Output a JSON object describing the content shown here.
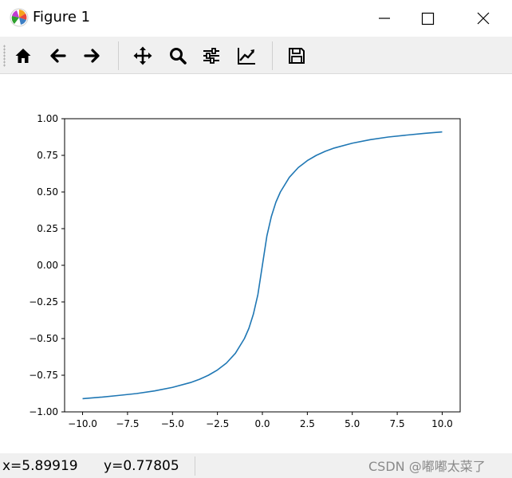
{
  "window": {
    "title": "Figure 1"
  },
  "toolbar": {
    "buttons": [
      {
        "name": "home",
        "icon": "home-icon"
      },
      {
        "name": "back",
        "icon": "arrow-left-icon"
      },
      {
        "name": "forward",
        "icon": "arrow-right-icon"
      },
      {
        "name": "pan",
        "icon": "move-icon"
      },
      {
        "name": "zoom",
        "icon": "magnifier-icon"
      },
      {
        "name": "configure-subplots",
        "icon": "sliders-icon"
      },
      {
        "name": "edit-axis",
        "icon": "line-chart-icon"
      },
      {
        "name": "save",
        "icon": "floppy-disk-icon"
      }
    ]
  },
  "status": {
    "x_readout": "x=5.89919",
    "y_readout": "y=0.77805",
    "watermark": "CSDN @嘟嘟太菜了"
  },
  "chart_data": {
    "type": "line",
    "title": "",
    "xlabel": "",
    "ylabel": "",
    "xlim": [
      -11.0,
      11.0
    ],
    "ylim": [
      -1.0,
      1.0
    ],
    "x_ticks": [
      -10.0,
      -7.5,
      -5.0,
      -2.5,
      0.0,
      2.5,
      5.0,
      7.5,
      10.0
    ],
    "x_tick_labels": [
      "−10.0",
      "−7.5",
      "−5.0",
      "−2.5",
      "0.0",
      "2.5",
      "5.0",
      "7.5",
      "10.0"
    ],
    "y_ticks": [
      -1.0,
      -0.75,
      -0.5,
      -0.25,
      0.0,
      0.25,
      0.5,
      0.75,
      1.0
    ],
    "y_tick_labels": [
      "−1.00",
      "−0.75",
      "−0.50",
      "−0.25",
      "0.00",
      "0.25",
      "0.50",
      "0.75",
      "1.00"
    ],
    "grid": false,
    "series": [
      {
        "color": "#1f77b4",
        "x": [
          -10.0,
          -9.0,
          -8.0,
          -7.0,
          -6.0,
          -5.0,
          -4.0,
          -3.5,
          -3.0,
          -2.5,
          -2.0,
          -1.5,
          -1.0,
          -0.75,
          -0.5,
          -0.25,
          0.0,
          0.25,
          0.5,
          0.75,
          1.0,
          1.5,
          2.0,
          2.5,
          3.0,
          3.5,
          4.0,
          5.0,
          6.0,
          7.0,
          8.0,
          9.0,
          10.0
        ],
        "y": [
          -0.91,
          -0.9,
          -0.888,
          -0.875,
          -0.857,
          -0.833,
          -0.8,
          -0.778,
          -0.75,
          -0.714,
          -0.667,
          -0.6,
          -0.5,
          -0.43,
          -0.333,
          -0.2,
          0.0,
          0.2,
          0.333,
          0.43,
          0.5,
          0.6,
          0.667,
          0.714,
          0.75,
          0.778,
          0.8,
          0.833,
          0.857,
          0.875,
          0.888,
          0.9,
          0.91
        ]
      }
    ]
  }
}
